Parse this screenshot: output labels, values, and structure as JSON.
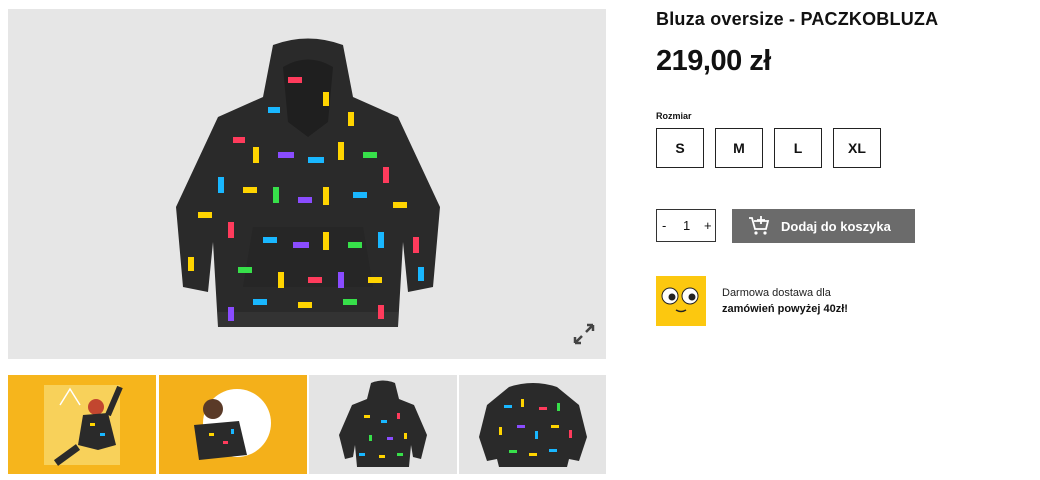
{
  "product": {
    "title": "Bluza oversize - PACZKOBLUZA",
    "price": "219,00 zł",
    "size_label": "Rozmiar",
    "sizes": [
      "S",
      "M",
      "L",
      "XL"
    ]
  },
  "cart": {
    "qty_minus": "-",
    "qty_value": "1",
    "qty_plus": "+",
    "add_label": "Dodaj do koszyka"
  },
  "promo": {
    "line1": "Darmowa dostawa dla",
    "line2": "zamówień powyżej 40zł!"
  },
  "icons": {
    "expand": "expand-arrows-icon",
    "cart": "add-to-cart-icon",
    "promo": "googly-eyes-icon"
  },
  "colors": {
    "brand_yellow": "#fcc80f",
    "button_gray": "#6b6b6b",
    "image_bg": "#e6e6e6"
  }
}
